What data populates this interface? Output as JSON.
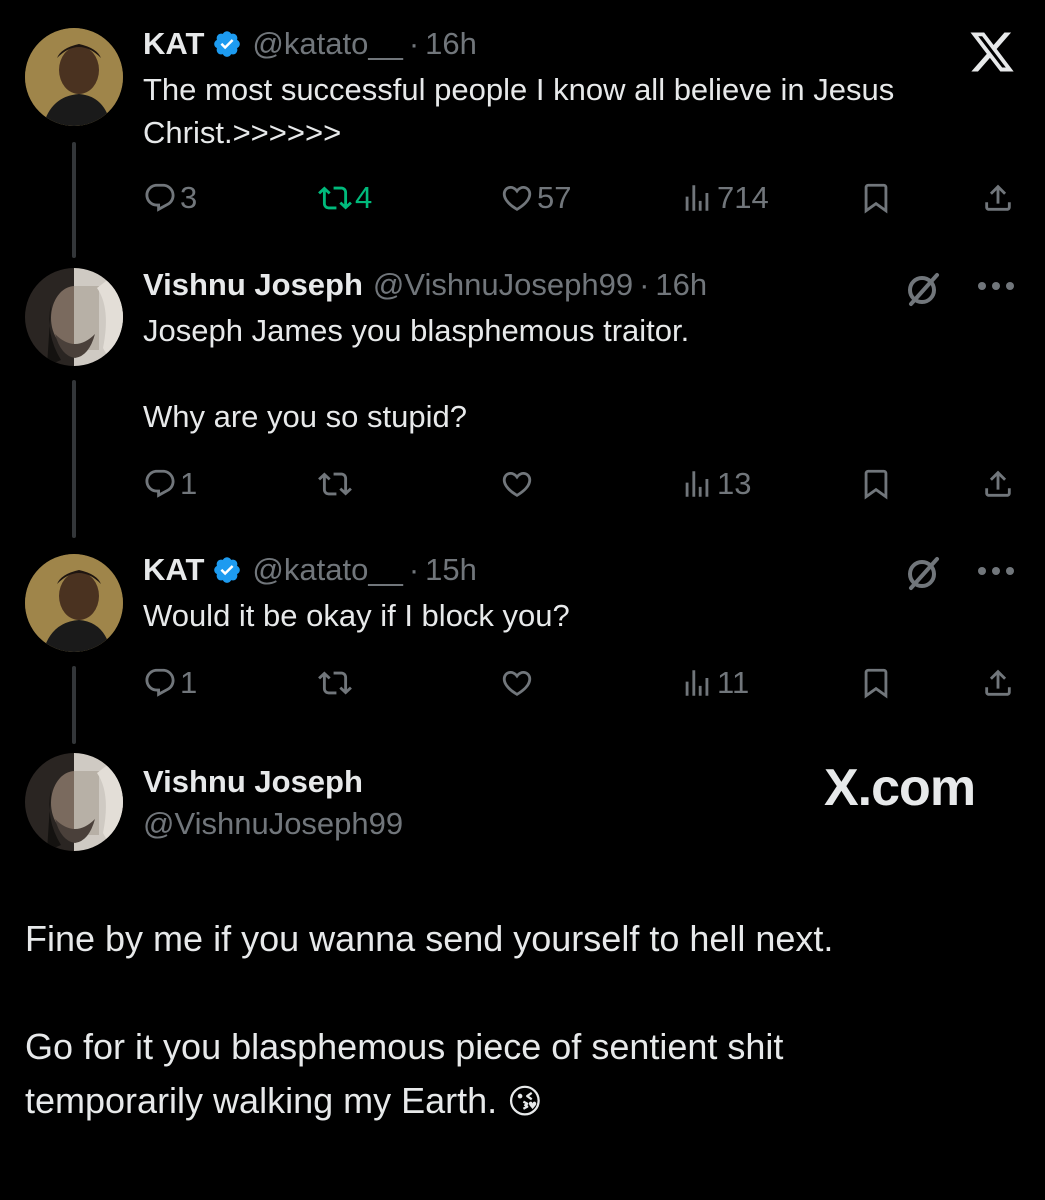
{
  "tweets": [
    {
      "name": "KAT",
      "handle": "@katato__",
      "sep": "·",
      "time": "16h",
      "text": "The most successful people I know all believe in Jesus\nChrist.>>>>>>",
      "replies": "3",
      "reposts": "4",
      "likes": "57",
      "views": "714"
    },
    {
      "name": "Vishnu Joseph",
      "handle": "@VishnuJoseph99",
      "sep": "·",
      "time": "16h",
      "text": "Joseph James you blasphemous traitor.\n\nWhy are you so stupid?",
      "replies": "1",
      "reposts": "",
      "likes": "",
      "views": "13"
    },
    {
      "name": "KAT",
      "handle": "@katato__",
      "sep": "·",
      "time": "15h",
      "text": "Would it be okay if I block you?",
      "replies": "1",
      "reposts": "",
      "likes": "",
      "views": "11"
    }
  ],
  "main_tweet": {
    "name": "Vishnu Joseph",
    "handle": "@VishnuJoseph99",
    "text": "Fine by me if you wanna send yourself to hell next.\n\nGo for it you blasphemous piece of sentient shit\ntemporarily walking my Earth.",
    "emoji": "😘"
  },
  "watermark": "X.com",
  "colors": {
    "background": "#000000",
    "text": "#e7e9ea",
    "muted": "#71767b",
    "verified": "#1d9bf0",
    "repost_active": "#00ba7c"
  },
  "icons": [
    "x-logo-icon",
    "verified-badge-icon",
    "reply-icon",
    "repost-icon",
    "like-icon",
    "views-icon",
    "bookmark-icon",
    "share-icon",
    "grok-icon",
    "more-icon"
  ]
}
